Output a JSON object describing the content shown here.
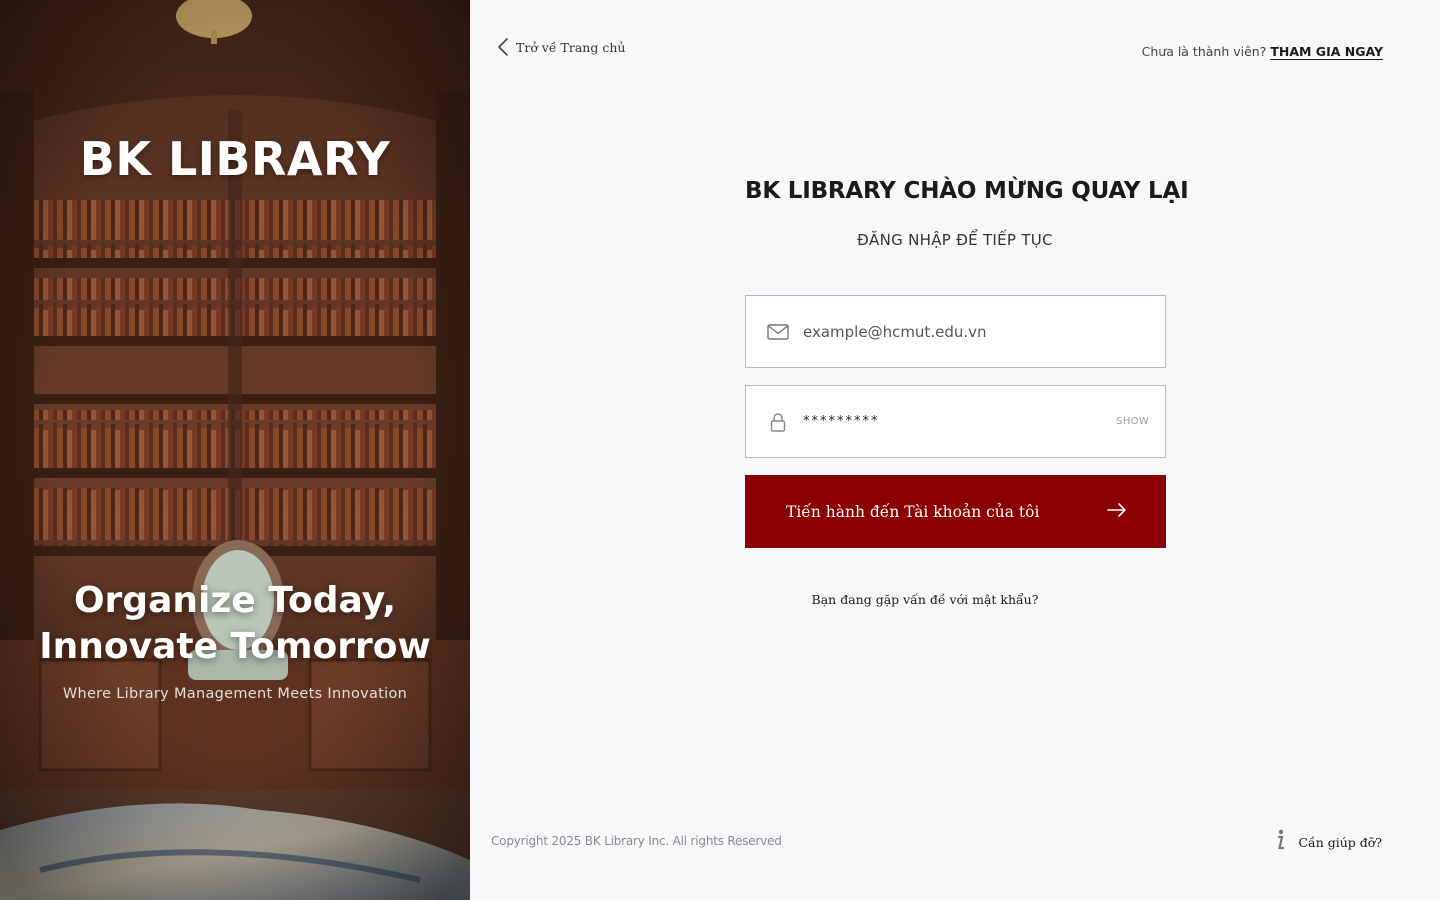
{
  "hero": {
    "brand": "BK LIBRARY",
    "slogan_line1": "Organize Today,",
    "slogan_line2": "Innovate Tomorrow",
    "tagline": "Where Library Management Meets Innovation"
  },
  "header": {
    "back_label": "Trở về Trang chủ",
    "signup_prompt": "Chưa là thành viên?",
    "signup_link": "THAM GIA NGAY"
  },
  "form": {
    "title": "BK LIBRARY CHÀO MỪNG QUAY LẠI",
    "subtitle": "ĐĂNG NHẬP ĐỂ TIẾP TỤC",
    "email_placeholder": "example@hcmut.edu.vn",
    "password_value": "*********",
    "show_label": "SHOW",
    "submit_label": "Tiến hành đến Tài khoản của tôi",
    "forgot_label": "Bạn đang gặp vấn đề với mật khẩu?"
  },
  "footer": {
    "copyright": "Copyright 2025 BK Library Inc. All rights Reserved",
    "help_label": "Cần giúp đỡ?"
  },
  "icons": {
    "back": "chevron-left-icon",
    "email": "mail-icon",
    "password": "lock-icon",
    "submit": "arrow-right-icon",
    "help": "info-icon"
  },
  "colors": {
    "accent": "#8b0000",
    "background": "#f8f8fa",
    "hero_base": "#6d3e2a"
  }
}
